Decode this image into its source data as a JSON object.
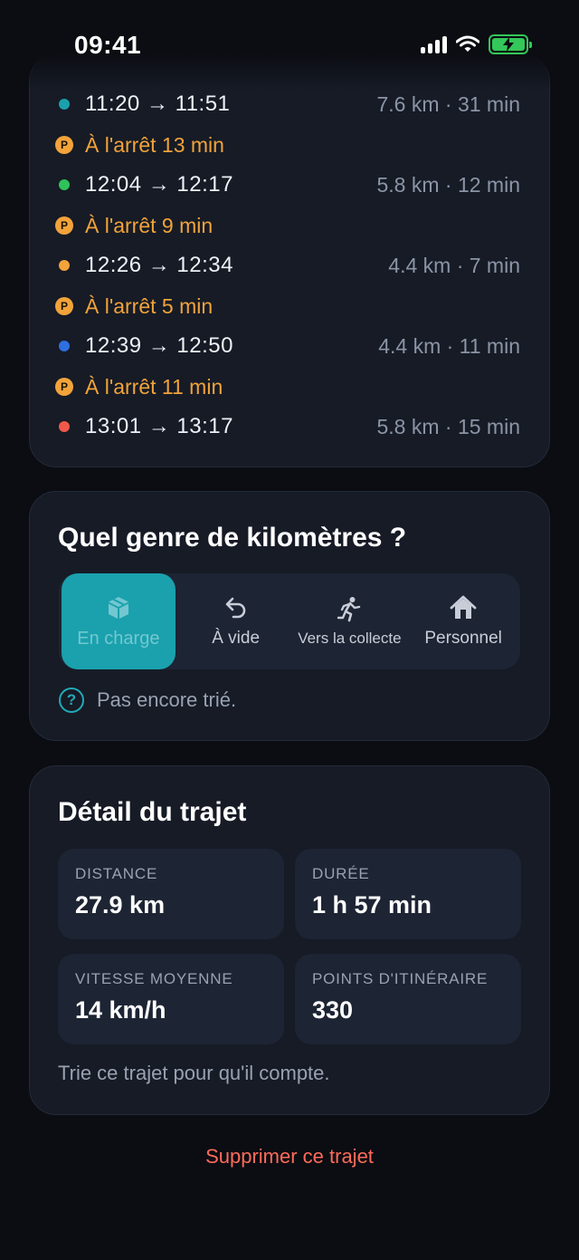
{
  "status": {
    "time": "09:41"
  },
  "segments": [
    {
      "type": "drive",
      "time": "11:20 → 11:51",
      "info": "7.6 km · 31 min",
      "color": "#1aa1ad"
    },
    {
      "type": "stop",
      "text": "À l'arrêt 13 min",
      "badge": "P"
    },
    {
      "type": "drive",
      "time": "12:04 → 12:17",
      "info": "5.8 km · 12 min",
      "color": "#2fc25b"
    },
    {
      "type": "stop",
      "text": "À l'arrêt 9 min",
      "badge": "P"
    },
    {
      "type": "drive",
      "time": "12:26 → 12:34",
      "info": "4.4 km · 7 min",
      "color": "#f2a33a"
    },
    {
      "type": "stop",
      "text": "À l'arrêt 5 min",
      "badge": "P"
    },
    {
      "type": "drive",
      "time": "12:39 → 12:50",
      "info": "4.4 km · 11 min",
      "color": "#2f6fe0"
    },
    {
      "type": "stop",
      "text": "À l'arrêt 11 min",
      "badge": "P"
    },
    {
      "type": "drive",
      "time": "13:01 → 13:17",
      "info": "5.8 km · 15 min",
      "color": "#f0584a"
    }
  ],
  "kind": {
    "title": "Quel genre de kilomètres ?",
    "options": [
      {
        "label": "En charge",
        "icon": "box-icon",
        "active": true
      },
      {
        "label": "À vide",
        "icon": "undo-arrow-icon",
        "active": false
      },
      {
        "label": "Vers la collecte",
        "icon": "runner-icon",
        "active": false
      },
      {
        "label": "Personnel",
        "icon": "house-icon",
        "active": false
      }
    ],
    "hint": "Pas encore trié."
  },
  "detail": {
    "title": "Détail du trajet",
    "distance_label": "DISTANCE",
    "distance_value": "27.9 km",
    "duration_label": "DURÉE",
    "duration_value": "1 h 57 min",
    "speed_label": "VITESSE MOYENNE",
    "speed_value": "14 km/h",
    "points_label": "POINTS D'ITINÉRAIRE",
    "points_value": "330",
    "footer": "Trie ce trajet pour qu'il compte."
  },
  "delete_label": "Supprimer ce trajet",
  "colors": {
    "accent": "#1aa1ad",
    "stop": "#f2a33a",
    "danger": "#ff6b5a"
  }
}
